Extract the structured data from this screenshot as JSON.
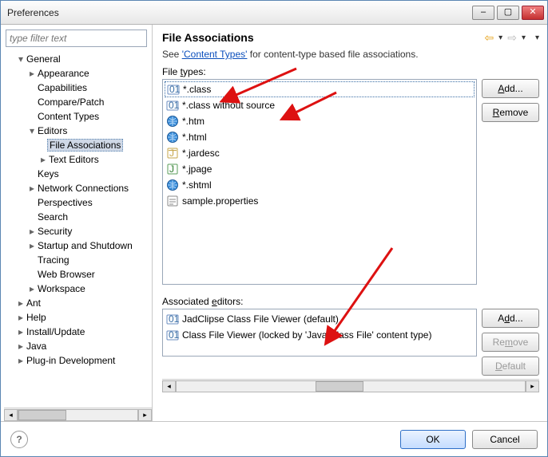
{
  "window": {
    "title": "Preferences"
  },
  "filter": {
    "placeholder": "type filter text"
  },
  "tree": {
    "general": {
      "label": "General",
      "appearance": "Appearance",
      "capabilities": "Capabilities",
      "compare": "Compare/Patch",
      "contentTypes": "Content Types",
      "editors": {
        "label": "Editors",
        "fileAssoc": "File Associations",
        "textEditors": "Text Editors"
      },
      "keys": "Keys",
      "network": "Network Connections",
      "perspectives": "Perspectives",
      "search": "Search",
      "security": "Security",
      "startup": "Startup and Shutdown",
      "tracing": "Tracing",
      "webbrowser": "Web Browser",
      "workspace": "Workspace"
    },
    "ant": "Ant",
    "help": "Help",
    "install": "Install/Update",
    "java": "Java",
    "pde": "Plug-in Development"
  },
  "page": {
    "title": "File Associations",
    "seePrefix": "See ",
    "contentTypesLink": "'Content Types'",
    "seeSuffix": " for content-type based file associations.",
    "fileTypesLabelPre": "File ",
    "fileTypesLabelU": "t",
    "fileTypesLabelPost": "ypes:",
    "assocLabelPre": "Associated ",
    "assocLabelU": "e",
    "assocLabelPost": "ditors:"
  },
  "fileTypes": [
    {
      "icon": "class",
      "name": "*.class",
      "selected": true
    },
    {
      "icon": "class",
      "name": "*.class without source"
    },
    {
      "icon": "globe",
      "name": "*.htm"
    },
    {
      "icon": "globe",
      "name": "*.html"
    },
    {
      "icon": "jar",
      "name": "*.jardesc"
    },
    {
      "icon": "jpage",
      "name": "*.jpage"
    },
    {
      "icon": "globe",
      "name": "*.shtml"
    },
    {
      "icon": "props",
      "name": "sample.properties"
    }
  ],
  "fileTypeButtons": {
    "addU": "A",
    "addRest": "dd...",
    "removeU": "R",
    "removeRest": "emove"
  },
  "editors": [
    {
      "icon": "class",
      "name": "JadClipse Class File Viewer (default)"
    },
    {
      "icon": "class",
      "name": "Class File Viewer (locked by 'Java Class File' content type)"
    }
  ],
  "editorButtons": {
    "addU": "d",
    "addPre": "A",
    "addPost": "d...",
    "removeU": "m",
    "removePre": "Re",
    "removePost": "ove",
    "defaultU": "D",
    "defaultRest": "efault"
  },
  "dialog": {
    "ok": "OK",
    "cancel": "Cancel"
  }
}
